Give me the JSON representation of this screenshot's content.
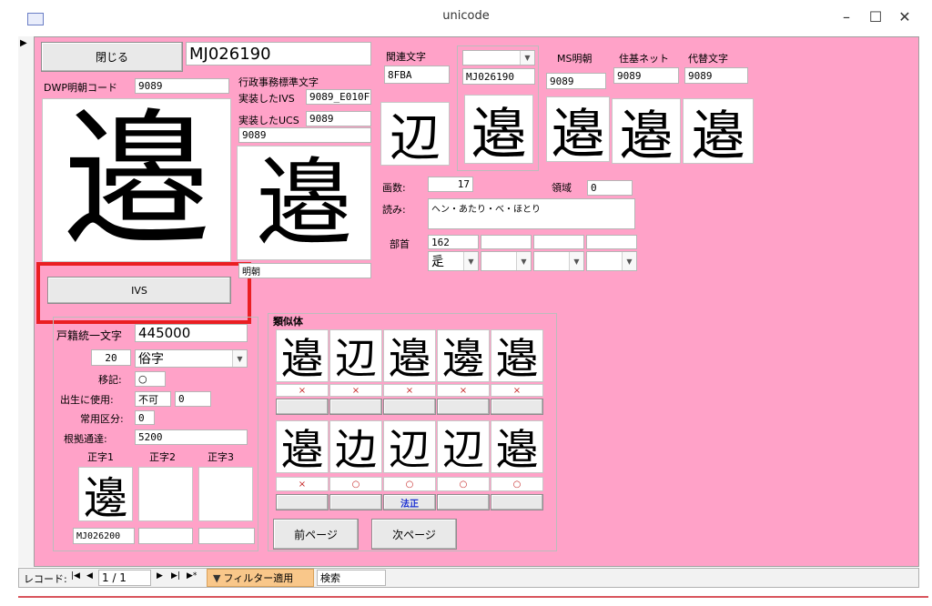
{
  "window": {
    "title": "unicode"
  },
  "left": {
    "close_label": "閉じる",
    "mj_code": "MJ026190",
    "dwp_label": "DWP明朝コード",
    "dwp_value": "9089",
    "big_glyph": "邉",
    "ivs_button": "IVS"
  },
  "gyosei": {
    "label": "行政事務標準文字",
    "ivs_label": "実装したIVS",
    "ivs_value": "9089_E010F",
    "ucs_label": "実装したUCS",
    "ucs_value": "9089",
    "extra_value": "9089",
    "glyph": "邉",
    "font_label": "明朝"
  },
  "related": {
    "label": "関連文字",
    "code": "8FBA",
    "glyph": "辺"
  },
  "combo_mj": {
    "value": "",
    "code": "MJ026190",
    "glyph": "邉"
  },
  "ms": {
    "label": "MS明朝",
    "code": "9089",
    "glyph": "邉"
  },
  "jukinet": {
    "label": "住基ネット",
    "code": "9089",
    "glyph": "邉"
  },
  "daitai": {
    "label": "代替文字",
    "code": "9089",
    "glyph": "邉"
  },
  "strokes": {
    "label": "画数:",
    "value": "17"
  },
  "region": {
    "label": "領域",
    "value": "0"
  },
  "reading": {
    "label": "読み:",
    "value": "ヘン・あたり・べ・ほとり"
  },
  "radical": {
    "label": "部首",
    "number": "162",
    "char": "辵"
  },
  "koseki": {
    "label": "戸籍統一文字",
    "value": "445000",
    "type_code": "20",
    "type_value": "俗字",
    "iki_label": "移記:",
    "iki_value": "○",
    "birth_label": "出生に使用:",
    "birth_value": "不可",
    "birth_num": "0",
    "joyo_label": "常用区分:",
    "joyo_value": "0",
    "tsutatsu_label": "根拠通達:",
    "tsutatsu_value": "5200",
    "seiji1_label": "正字1",
    "seiji2_label": "正字2",
    "seiji3_label": "正字3",
    "seiji1_glyph": "邊",
    "seiji1_code": "MJ026200"
  },
  "similar": {
    "label": "類似体",
    "row1": [
      {
        "glyph": "邉",
        "mark": "×"
      },
      {
        "glyph": "辺",
        "mark": "×"
      },
      {
        "glyph": "邉",
        "mark": "×"
      },
      {
        "glyph": "邊",
        "mark": "×"
      },
      {
        "glyph": "邉",
        "mark": "×"
      }
    ],
    "row2": [
      {
        "glyph": "邉",
        "mark": "×"
      },
      {
        "glyph": "边",
        "mark": "○"
      },
      {
        "glyph": "辺",
        "mark": "○"
      },
      {
        "glyph": "辺",
        "mark": "○"
      },
      {
        "glyph": "邉",
        "mark": "○"
      }
    ],
    "hosei": "法正",
    "prev_label": "前ページ",
    "next_label": "次ページ"
  },
  "navbar": {
    "record_label": "レコード:",
    "first": "◀",
    "prev": "◀",
    "current": "1 / 1",
    "next": "▶",
    "last": "▶",
    "new": "▶",
    "filter_label": "フィルター適用",
    "search_label": "検索"
  }
}
